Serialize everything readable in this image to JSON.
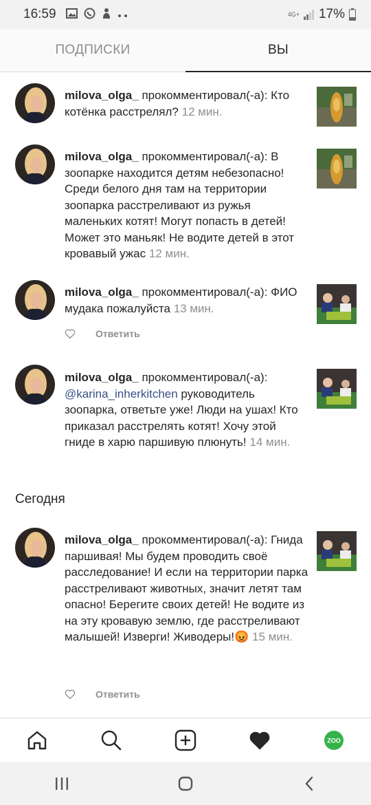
{
  "status_bar": {
    "time": "16:59",
    "network": "4G+",
    "battery": "17%",
    "left_icons": [
      "gallery-icon",
      "whatsapp-icon",
      "app-icon",
      "more-icon"
    ]
  },
  "tabs": [
    {
      "label": "ПОДПИСКИ",
      "active": false
    },
    {
      "label": "ВЫ",
      "active": true
    }
  ],
  "section_today": "Сегодня",
  "reply_label": "Ответить",
  "notifications": [
    {
      "user": "milova_olga_",
      "action": " прокомментировал(-а): ",
      "text": "Кто котёнка расстрелял?",
      "time": "12 мин.",
      "thumb": "fountain"
    },
    {
      "user": "milova_olga_",
      "action": " прокомментировал(-а): ",
      "text": "В зоопарке находится детям небезопасно! Среди белого дня там на территории зоопарка расстреливают из ружья маленьких котят! Могут попасть в детей! Может это маньяк! Не водите детей в этот кровавый ужас",
      "time": "12 мин.",
      "thumb": "fountain"
    },
    {
      "user": "milova_olga_",
      "action": " прокомментировал(-а): ",
      "text": "ФИО мудака пожалуйста",
      "time": "13 мин.",
      "thumb": "people"
    },
    {
      "user": "milova_olga_",
      "action": " прокомментировал(-а): ",
      "mention": "@karina_inherkitchen",
      "text": " руководитель зоопарка, ответьте уже! Люди на ушах! Кто приказал расстрелять котят! Хочу этой гниде в харю паршивую плюнуть!",
      "time": "14 мин.",
      "thumb": "people"
    },
    {
      "user": "milova_olga_",
      "action": " прокомментировал(-а): ",
      "text": "Гнида паршивая! Мы будем проводить своё расследование! И если на территории парка расстреливают животных, значит летят там опасно! Берегите своих детей! Не водите из на эту кровавую землю, где расстреливают малышей! Изверги! Живодеры!",
      "emoji": "😡",
      "time": "15 мин.",
      "thumb": "people"
    }
  ],
  "bottom_nav": [
    "home-icon",
    "search-icon",
    "add-post-icon",
    "heart-icon",
    "profile-avatar"
  ],
  "profile_badge": "ZOO",
  "system_nav": [
    "recent-apps-icon",
    "home-button-icon",
    "back-icon"
  ]
}
